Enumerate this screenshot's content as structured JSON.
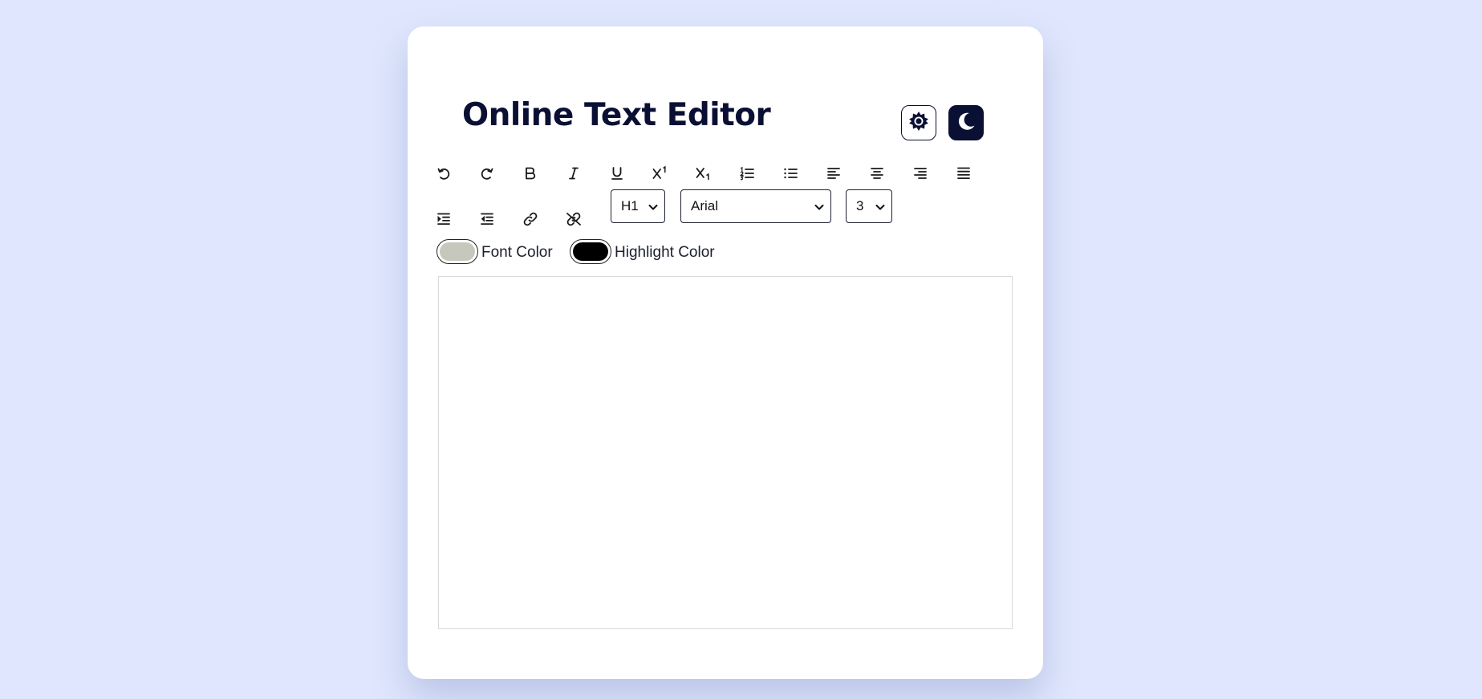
{
  "app": {
    "title": "Online Text Editor"
  },
  "theme_toggle": {
    "light_icon": "sun-icon",
    "dark_icon": "moon-icon"
  },
  "toolbar": {
    "row1": [
      {
        "name": "undo-button",
        "icon": "undo-icon"
      },
      {
        "name": "redo-button",
        "icon": "redo-icon"
      },
      {
        "name": "bold-button",
        "icon": "bold-icon"
      },
      {
        "name": "italic-button",
        "icon": "italic-icon"
      },
      {
        "name": "underline-button",
        "icon": "underline-icon"
      },
      {
        "name": "superscript-button",
        "icon": "superscript-icon"
      },
      {
        "name": "subscript-button",
        "icon": "subscript-icon"
      },
      {
        "name": "ordered-list-button",
        "icon": "ordered-list-icon"
      },
      {
        "name": "unordered-list-button",
        "icon": "unordered-list-icon"
      },
      {
        "name": "align-left-button",
        "icon": "align-left-icon"
      },
      {
        "name": "align-center-button",
        "icon": "align-center-icon"
      },
      {
        "name": "align-right-button",
        "icon": "align-right-icon"
      },
      {
        "name": "justify-button",
        "icon": "justify-icon"
      }
    ],
    "row2": [
      {
        "name": "indent-button",
        "icon": "indent-icon"
      },
      {
        "name": "outdent-button",
        "icon": "outdent-icon"
      },
      {
        "name": "create-link-button",
        "icon": "link-icon"
      },
      {
        "name": "unlink-button",
        "icon": "unlink-icon"
      }
    ],
    "heading_select": {
      "selected": "H1"
    },
    "font_select": {
      "selected": "Arial"
    },
    "size_select": {
      "selected": "3"
    }
  },
  "colors": {
    "font_color_label": "Font Color",
    "font_color_value": "#c6c8bd",
    "highlight_color_label": "Highlight Color",
    "highlight_color_value": "#000000"
  },
  "editor": {
    "content": ""
  },
  "palette": {
    "background": "#dfe6fd",
    "card": "#ffffff",
    "accent_dark": "#0a1033"
  }
}
